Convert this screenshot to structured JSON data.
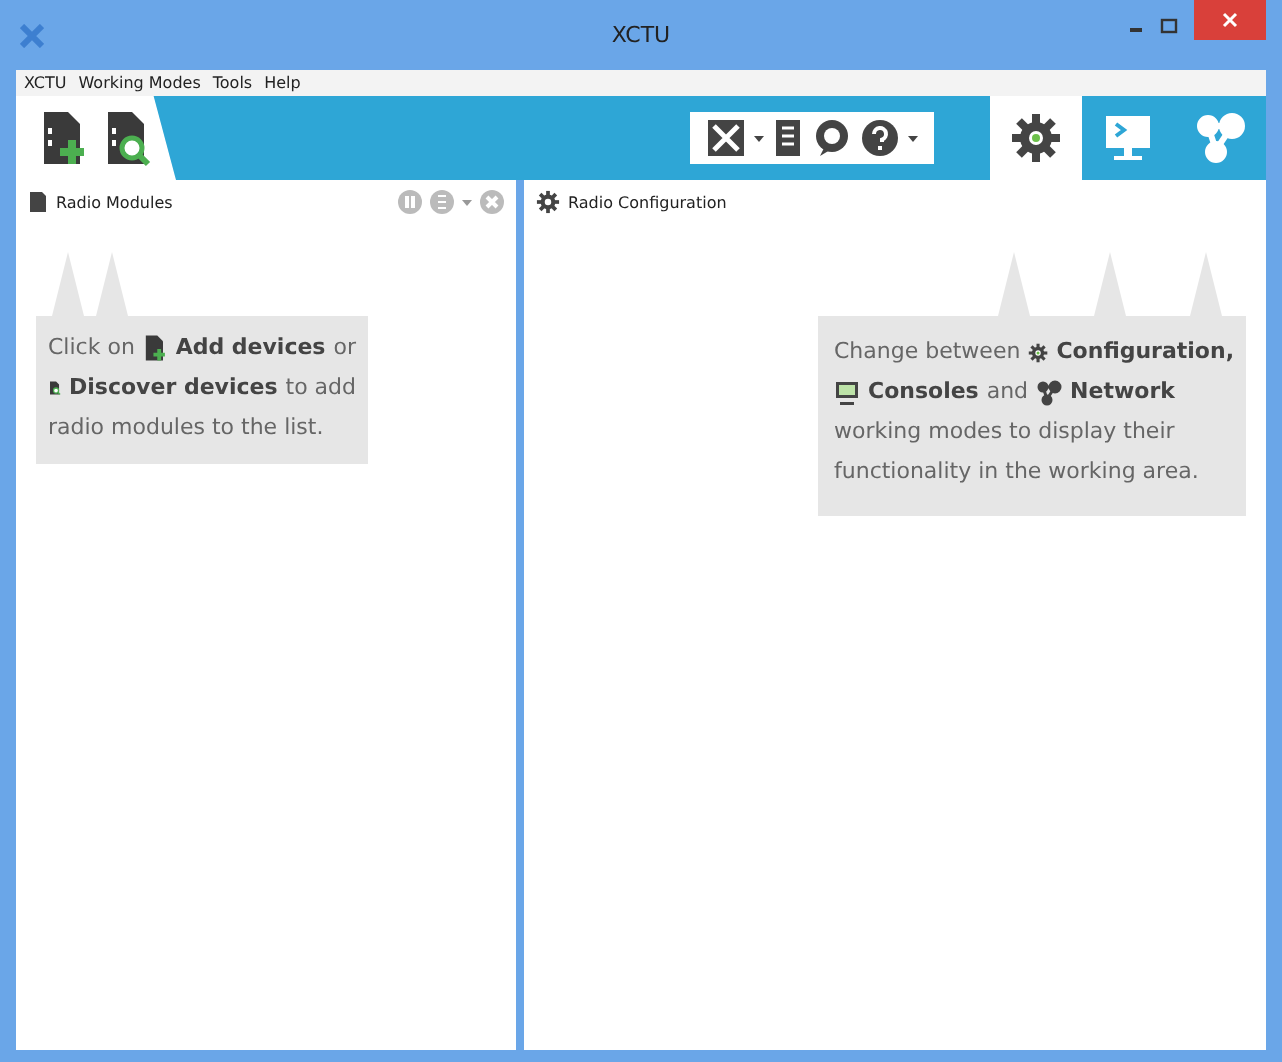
{
  "window": {
    "title": "XCTU"
  },
  "menu": [
    "XCTU",
    "Working Modes",
    "Tools",
    "Help"
  ],
  "modes": [
    {
      "kind": "config",
      "selected": true
    },
    {
      "kind": "console",
      "selected": false
    },
    {
      "kind": "network",
      "selected": false
    }
  ],
  "left_panel": {
    "title": "Radio Modules",
    "tip": [
      [
        {
          "kind": "text",
          "text": "Click on"
        },
        {
          "kind": "add"
        },
        {
          "kind": "strong",
          "text": "Add devices"
        },
        {
          "kind": "text",
          "text": "or"
        }
      ],
      [
        {
          "kind": "discover"
        },
        {
          "kind": "strong",
          "text": "Discover devices"
        },
        {
          "kind": "text",
          "text": "to add"
        }
      ],
      [
        {
          "kind": "text",
          "text": "radio modules to the list."
        }
      ]
    ]
  },
  "right_panel": {
    "title": "Radio Configuration",
    "tip": [
      [
        {
          "kind": "text",
          "text": "Change between"
        },
        {
          "kind": "gear"
        },
        {
          "kind": "strong",
          "text": "Configuration,"
        }
      ],
      [
        {
          "kind": "monitor"
        },
        {
          "kind": "strong",
          "text": "Consoles"
        },
        {
          "kind": "text",
          "text": "and"
        },
        {
          "kind": "network"
        },
        {
          "kind": "strong",
          "text": "Network"
        }
      ],
      [
        {
          "kind": "text",
          "text": "working modes to display their"
        }
      ],
      [
        {
          "kind": "text",
          "text": "functionality in the working area."
        }
      ]
    ]
  }
}
